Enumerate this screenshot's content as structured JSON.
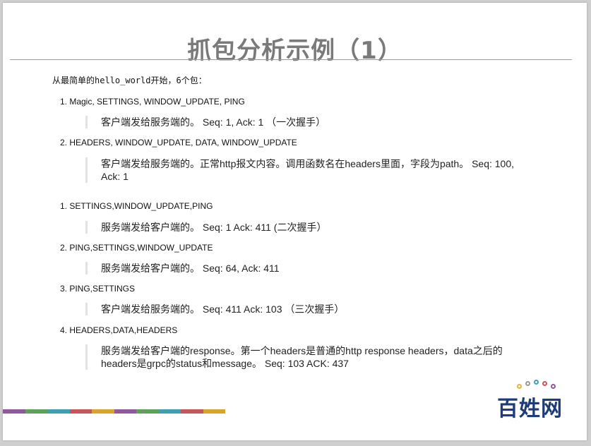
{
  "title": "抓包分析示例（1）",
  "intro": "从最简单的hello_world开始，6个包：",
  "group1": [
    {
      "item": "1. Magic, SETTINGS, WINDOW_UPDATE, PING",
      "quote": "客户端发给服务端的。 Seq: 1, Ack: 1 （一次握手）"
    },
    {
      "item": "2. HEADERS, WINDOW_UPDATE, DATA, WINDOW_UPDATE",
      "quote_line1": "客户端发给服务端的。正常http报文内容。调用函数名在headers里面，字段为path。 Seq: 100,",
      "quote_line2": "Ack: 1"
    }
  ],
  "group2": [
    {
      "item": "1. SETTINGS,WINDOW_UPDATE,PING",
      "quote": "服务端发给客户端的。 Seq: 1 Ack: 411 (二次握手）"
    },
    {
      "item": "2. PING,SETTINGS,WINDOW_UPDATE",
      "quote": "服务端发给客户端的。 Seq: 64, Ack: 411"
    },
    {
      "item": "3. PING,SETTINGS",
      "quote": "客户端发给服务端的。 Seq: 411 Ack: 103 （三次握手）"
    },
    {
      "item": "4. HEADERS,DATA,HEADERS",
      "quote_line1": "服务端发给客户端的response。第一个headers是普通的http response headers，data之后的",
      "quote_line2": "headers是grpc的status和message。 Seq: 103 ACK: 437"
    }
  ],
  "footer": {
    "color_bar": [
      "#8e5a9b",
      "#5fa05a",
      "#3f9fb2",
      "#c8555c",
      "#d8a42c",
      "#8e5a9b",
      "#5fa05a",
      "#3f9fb2",
      "#c8555c",
      "#d8a42c"
    ],
    "logo_text": "百姓网",
    "logo_dot_colors": [
      "#e7b532",
      "#9a9a9a",
      "#3f9fb2",
      "#c8555c",
      "#8e5a9b"
    ]
  }
}
